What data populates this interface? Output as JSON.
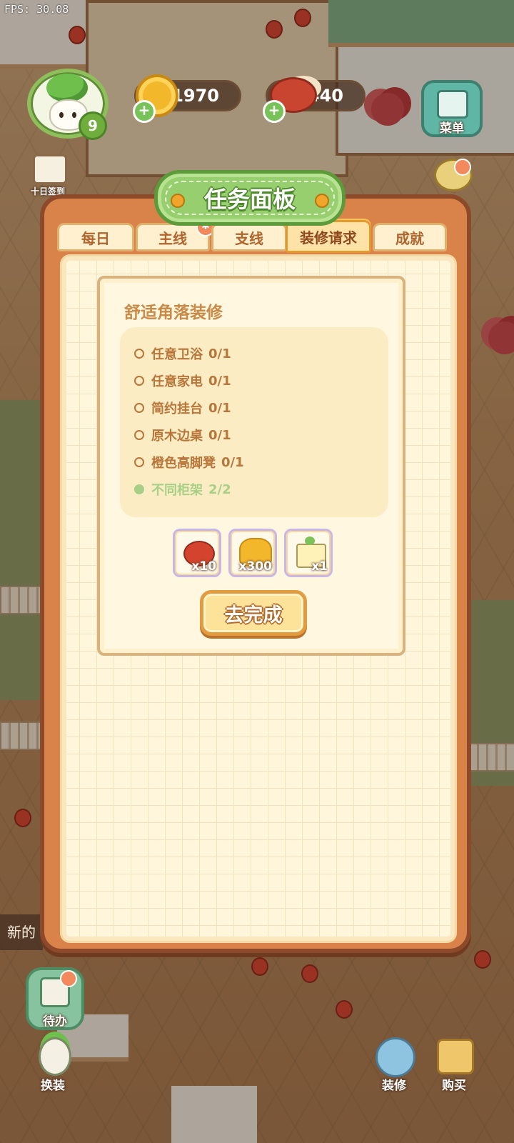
{
  "fps": "FPS: 30.08",
  "hud": {
    "level": "9",
    "coins": "1970",
    "food": "440",
    "plus": "+",
    "menu_label": "菜单",
    "sign_label": "十日签到",
    "todo_label": "待办",
    "dress_label": "换装",
    "deco_label": "装修",
    "buy_label": "购买",
    "news_text": "新的"
  },
  "panel": {
    "title": "任务面板",
    "tabs": [
      {
        "label": "每日"
      },
      {
        "label": "主线"
      },
      {
        "label": "支线"
      },
      {
        "label": "装修请求"
      },
      {
        "label": "成就"
      }
    ],
    "active_tab": "装修请求"
  },
  "task": {
    "title": "舒适角落装修",
    "requirements": [
      {
        "name": "任意卫浴",
        "progress": "0/1",
        "done": false
      },
      {
        "name": "任意家电",
        "progress": "0/1",
        "done": false
      },
      {
        "name": "简约挂台",
        "progress": "0/1",
        "done": false
      },
      {
        "name": "原木边桌",
        "progress": "0/1",
        "done": false
      },
      {
        "name": "橙色高脚凳",
        "progress": "0/1",
        "done": false
      },
      {
        "name": "不同柜架",
        "progress": "2/2",
        "done": true
      }
    ],
    "rewards": [
      {
        "icon": "meat-icon",
        "qty": "x10"
      },
      {
        "icon": "coin-pile-icon",
        "qty": "x300"
      },
      {
        "icon": "seed-box-icon",
        "qty": "x1"
      }
    ],
    "go_button": "去完成"
  },
  "colors": {
    "panel_frame": "#d9834a",
    "title_green": "#97cf6e",
    "text_brown": "#b8763a",
    "done_green": "#a7cf86",
    "button_yellow": "#fde39a"
  }
}
